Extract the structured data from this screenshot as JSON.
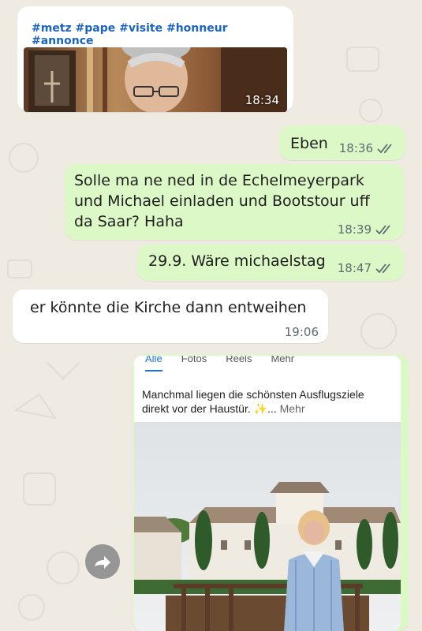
{
  "messages": {
    "post": {
      "hashtags": "#metz #pape #visite #honneur #annonce",
      "time": "18:34"
    },
    "eben": {
      "text": "Eben",
      "time": "18:36"
    },
    "solle": {
      "text": "Solle ma ne ned in de Echelmeyerpark und Michael einladen und Bootstour uff da Saar?  Haha",
      "time": "18:39"
    },
    "michaelstag": {
      "text": "29.9. Wäre michaelstag",
      "time": "18:47"
    },
    "kirche": {
      "text": "er könnte die Kirche dann entweihen",
      "time": "19:06"
    },
    "screenshot": {
      "tabs": [
        "Alle",
        "Fotos",
        "Reels",
        "Mehr"
      ],
      "caption": "Manchmal liegen die schönsten Ausflugsziele direkt vor der Haustür. ✨...",
      "caption_more": "Mehr"
    }
  },
  "colors": {
    "incoming": "#ffffff",
    "outgoing": "#dcf8c6",
    "read_ticks": "#5f6a6f",
    "hashtag": "#1c64c4"
  },
  "icons": {
    "ticks": "double-check-icon",
    "forward": "forward-icon"
  }
}
